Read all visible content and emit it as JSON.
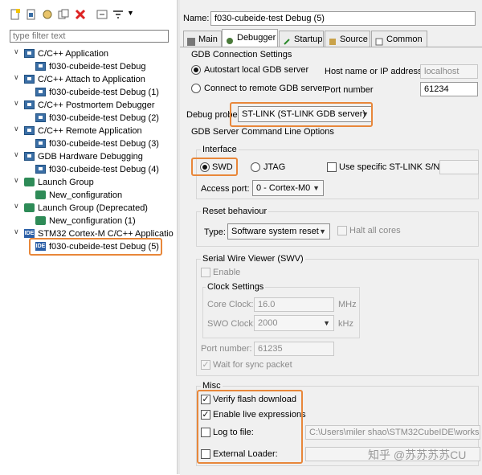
{
  "left": {
    "filter_placeholder": "type filter text",
    "tree": [
      {
        "label": "C/C++ Application",
        "kind": "cfg",
        "level": 0
      },
      {
        "label": "f030-cubeide-test Debug",
        "kind": "cfg",
        "level": 1
      },
      {
        "label": "C/C++ Attach to Application",
        "kind": "cfg",
        "level": 0
      },
      {
        "label": "f030-cubeide-test Debug (1)",
        "kind": "cfg",
        "level": 1
      },
      {
        "label": "C/C++ Postmortem Debugger",
        "kind": "cfg",
        "level": 0
      },
      {
        "label": "f030-cubeide-test Debug (2)",
        "kind": "cfg",
        "level": 1
      },
      {
        "label": "C/C++ Remote Application",
        "kind": "cfg",
        "level": 0
      },
      {
        "label": "f030-cubeide-test Debug (3)",
        "kind": "cfg",
        "level": 1
      },
      {
        "label": "GDB Hardware Debugging",
        "kind": "cfg",
        "level": 0
      },
      {
        "label": "f030-cubeide-test Debug (4)",
        "kind": "cfg",
        "level": 1
      },
      {
        "label": "Launch Group",
        "kind": "launch",
        "level": 0
      },
      {
        "label": "New_configuration",
        "kind": "launch",
        "level": 1
      },
      {
        "label": "Launch Group (Deprecated)",
        "kind": "launch",
        "level": 0
      },
      {
        "label": "New_configuration (1)",
        "kind": "launch",
        "level": 1
      },
      {
        "label": "STM32 Cortex-M C/C++ Applicatio",
        "kind": "ide",
        "level": 0
      },
      {
        "label": "f030-cubeide-test Debug (5)",
        "kind": "ide",
        "level": 1
      }
    ]
  },
  "right": {
    "name_label": "Name:",
    "name_value": "f030-cubeide-test Debug (5)",
    "tabs": [
      "Main",
      "Debugger",
      "Startup",
      "Source",
      "Common"
    ],
    "gdb_connection": {
      "title": "GDB Connection Settings",
      "autostart": "Autostart local GDB server",
      "remote": "Connect to remote GDB server",
      "host_label": "Host name or IP address",
      "host_value": "localhost",
      "port_label": "Port number",
      "port_value": "61234"
    },
    "debug_probe": {
      "label": "Debug probe",
      "value": "ST-LINK (ST-LINK GDB server)"
    },
    "server_options_title": "GDB Server Command Line Options",
    "interface": {
      "title": "Interface",
      "swd": "SWD",
      "jtag": "JTAG",
      "use_sn": "Use specific ST-LINK S/N",
      "access_port_label": "Access port:",
      "access_port_value": "0 - Cortex-M0"
    },
    "reset": {
      "title": "Reset behaviour",
      "type_label": "Type:",
      "type_value": "Software system reset",
      "halt_all": "Halt all cores"
    },
    "swv": {
      "title": "Serial Wire Viewer (SWV)",
      "enable": "Enable",
      "clock_title": "Clock Settings",
      "core_label": "Core Clock:",
      "core_value": "16.0",
      "core_unit": "MHz",
      "swo_label": "SWO Clock:",
      "swo_value": "2000",
      "swo_unit": "kHz",
      "port_label": "Port number:",
      "port_value": "61235",
      "wait": "Wait for sync packet"
    },
    "misc": {
      "title": "Misc",
      "verify": "Verify flash download",
      "live": "Enable live expressions",
      "log": "Log to file:",
      "log_path": "C:\\Users\\miler shao\\STM32CubeIDE\\workspa",
      "ext_loader": "External Loader:"
    },
    "watermark": "知乎 @苏苏苏苏CU"
  },
  "colors": {
    "highlight": "#e8873a",
    "panel": "#f0f0f0"
  }
}
